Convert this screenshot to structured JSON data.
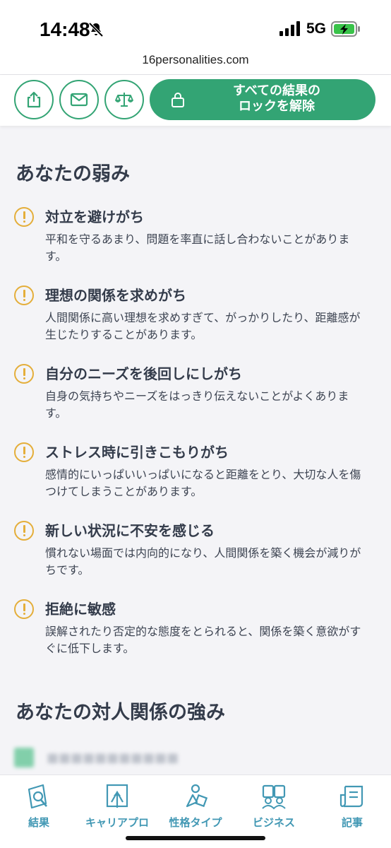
{
  "status_bar": {
    "time": "14:48",
    "network": "5G"
  },
  "browser": {
    "url": "16personalities.com"
  },
  "toolbar": {
    "unlock_label": "すべての結果の\nロックを解除"
  },
  "sections": [
    {
      "title": "あなたの弱み"
    },
    {
      "title": "あなたの対人関係の強み"
    }
  ],
  "weaknesses": [
    {
      "title": "対立を避けがち",
      "desc": "平和を守るあまり、問題を率直に話し合わないことがあります。"
    },
    {
      "title": "理想の関係を求めがち",
      "desc": "人間関係に高い理想を求めすぎて、がっかりしたり、距離感が生じたりすることがあります。"
    },
    {
      "title": "自分のニーズを後回しにしがち",
      "desc": "自身の気持ちやニーズをはっきり伝えないことがよくあります。"
    },
    {
      "title": "ストレス時に引きこもりがち",
      "desc": "感情的にいっぱいいっぱいになると距離をとり、大切な人を傷つけてしまうことがあります。"
    },
    {
      "title": "新しい状況に不安を感じる",
      "desc": "慣れない場面では内向的になり、人間関係を築く機会が減りがちです。"
    },
    {
      "title": "拒絶に敏感",
      "desc": "誤解されたり否定的な態度をとられると、関係を築く意欲がすぐに低下します。"
    }
  ],
  "bottom_nav": [
    {
      "label": "結果",
      "icon": "results-icon"
    },
    {
      "label": "キャリアプロ",
      "icon": "career-icon"
    },
    {
      "label": "性格タイプ",
      "icon": "personality-types-icon"
    },
    {
      "label": "ビジネス",
      "icon": "business-icon"
    },
    {
      "label": "記事",
      "icon": "articles-icon"
    }
  ],
  "colors": {
    "accent_green": "#33a474",
    "warning_yellow": "#e4ae3a",
    "nav_blue": "#4298b4",
    "text_dark": "#343c4b",
    "background": "#f4f4f7"
  }
}
